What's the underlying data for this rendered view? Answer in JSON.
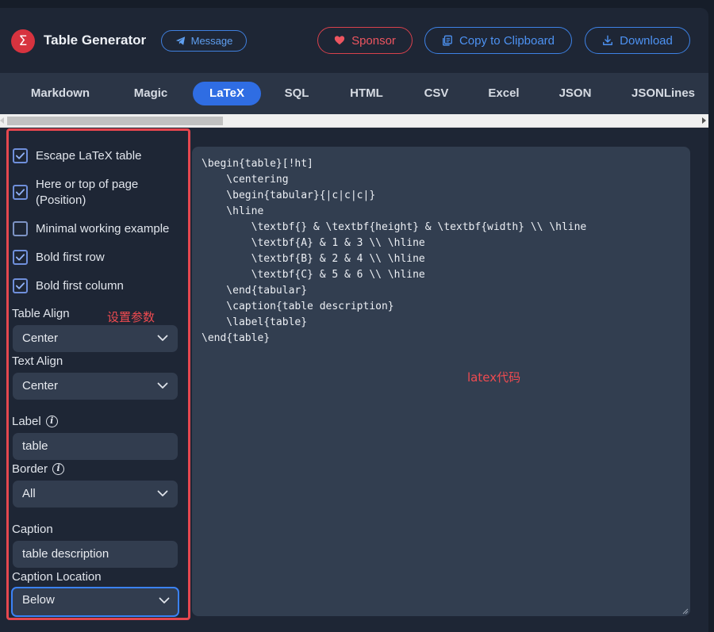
{
  "header": {
    "app_title": "Table Generator",
    "logo_glyph": "Σ",
    "message_label": "Message",
    "sponsor_label": "Sponsor",
    "copy_label": "Copy to Clipboard",
    "download_label": "Download"
  },
  "tabs": [
    {
      "label": "Markdown",
      "active": false
    },
    {
      "label": "Magic",
      "active": false
    },
    {
      "label": "LaTeX",
      "active": true
    },
    {
      "label": "SQL",
      "active": false
    },
    {
      "label": "HTML",
      "active": false
    },
    {
      "label": "CSV",
      "active": false
    },
    {
      "label": "Excel",
      "active": false
    },
    {
      "label": "JSON",
      "active": false
    },
    {
      "label": "JSONLines",
      "active": false
    }
  ],
  "settings": {
    "options": [
      {
        "label": "Escape LaTeX table",
        "checked": true
      },
      {
        "label": "Here or top of page (Position)",
        "checked": true
      },
      {
        "label": "Minimal working example",
        "checked": false
      },
      {
        "label": "Bold first row",
        "checked": true
      },
      {
        "label": "Bold first column",
        "checked": true
      }
    ],
    "table_align_label": "Table Align",
    "table_align_value": "Center",
    "text_align_label": "Text Align",
    "text_align_value": "Center",
    "label_label": "Label",
    "label_value": "table",
    "border_label": "Border",
    "border_value": "All",
    "caption_label": "Caption",
    "caption_value": "table description",
    "caption_location_label": "Caption Location",
    "caption_location_value": "Below"
  },
  "annotations": {
    "settings_note": "设置参数",
    "code_note": "latex代码"
  },
  "code": {
    "latex": "\\begin{table}[!ht]\n    \\centering\n    \\begin{tabular}{|c|c|c|}\n    \\hline\n        \\textbf{} & \\textbf{height} & \\textbf{width} \\\\ \\hline\n        \\textbf{A} & 1 & 3 \\\\ \\hline\n        \\textbf{B} & 2 & 4 \\\\ \\hline\n        \\textbf{C} & 5 & 6 \\\\ \\hline\n    \\end{tabular}\n    \\caption{table description}\n    \\label{table}\n\\end{table}"
  },
  "colors": {
    "accent": "#2f6de3",
    "sponsor": "#e84b55",
    "annotation": "#ef4b50",
    "background": "#1e2635"
  }
}
